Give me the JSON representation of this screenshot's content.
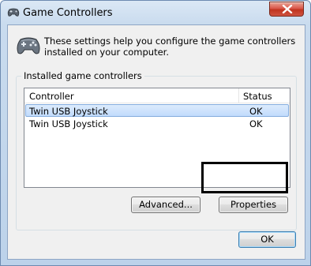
{
  "window": {
    "title": "Game Controllers",
    "title_icon": "gamepad-icon",
    "close_icon": "close-icon"
  },
  "intro": {
    "icon": "gamepad-icon",
    "text": "These settings help you configure the game controllers installed on your computer."
  },
  "group": {
    "label": "Installed game controllers",
    "columns": [
      "Controller",
      "Status"
    ],
    "rows": [
      {
        "controller": "Twin USB Joystick",
        "status": "OK",
        "selected": true
      },
      {
        "controller": "Twin USB Joystick",
        "status": "OK",
        "selected": false
      }
    ]
  },
  "buttons": {
    "advanced": "Advanced...",
    "properties": "Properties",
    "ok": "OK"
  },
  "colors": {
    "selection": "#c1dbfc",
    "highlight_border": "#000000",
    "close_red": "#c0341f"
  }
}
